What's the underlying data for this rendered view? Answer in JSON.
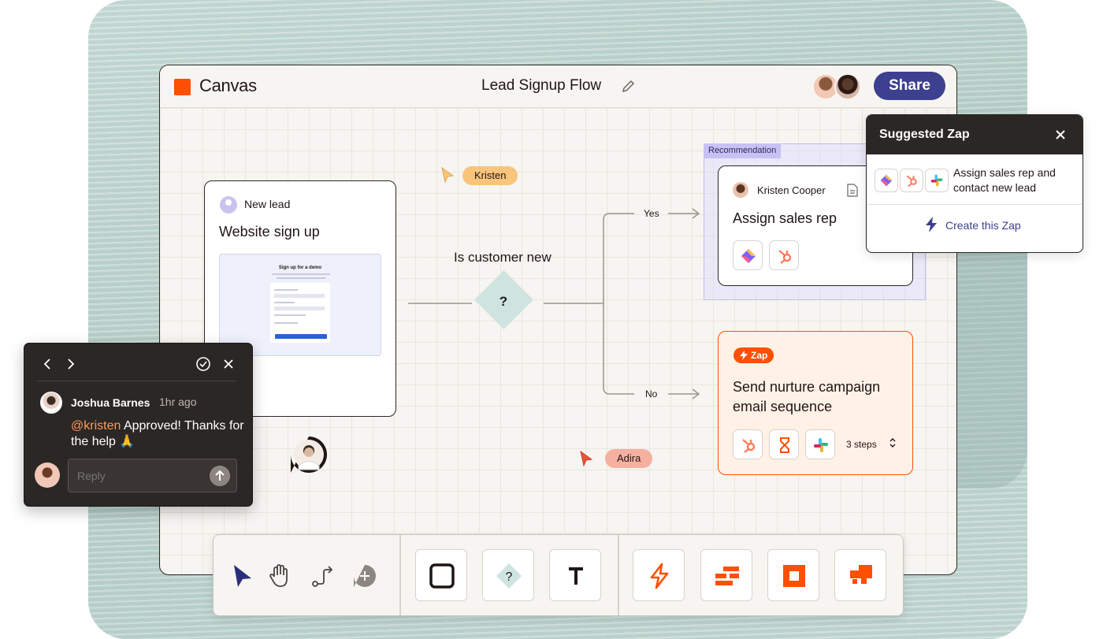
{
  "app": {
    "name": "Canvas",
    "document_title": "Lead Signup Flow",
    "share_label": "Share",
    "brand_color": "#ff4f00",
    "accent_color": "#3d3f8f"
  },
  "flow": {
    "trigger": {
      "kind_label": "New lead",
      "title": "Website sign up",
      "preview_title": "Sign up for a demo"
    },
    "decision": {
      "question": "Is customer new",
      "symbol": "?"
    },
    "branches": {
      "yes_label": "Yes",
      "no_label": "No"
    },
    "recommendation": {
      "tag": "Recommendation",
      "assignee": "Kristen Cooper",
      "title": "Assign sales rep",
      "apps": [
        "zapier-interfaces-icon",
        "hubspot-icon"
      ]
    },
    "zap_step": {
      "pill_label": "Zap",
      "title": "Send nurture campaign email sequence",
      "steps_label": "3 steps",
      "apps": [
        "hubspot-icon",
        "hourglass-icon",
        "slack-icon"
      ]
    }
  },
  "cursors": [
    {
      "name": "Kristen",
      "color": "#f9c47c"
    },
    {
      "name": "Adira",
      "color": "#f6b0a0"
    }
  ],
  "suggested_zap": {
    "title": "Suggested Zap",
    "description": "Assign sales rep and contact new lead",
    "create_label": "Create this Zap"
  },
  "comment": {
    "author": "Joshua Barnes",
    "time": "1hr ago",
    "mention": "@kristen",
    "message": " Approved! Thanks for the help 🙏",
    "reply_placeholder": "Reply"
  },
  "toolbar": {
    "groups": [
      [
        "select-icon",
        "hand-icon",
        "connector-icon",
        "add-comment-icon"
      ],
      [
        "rectangle-icon",
        "decision-icon",
        "text-icon"
      ],
      [
        "zap-icon",
        "tables-icon",
        "interfaces-icon",
        "chatbot-icon"
      ]
    ]
  }
}
